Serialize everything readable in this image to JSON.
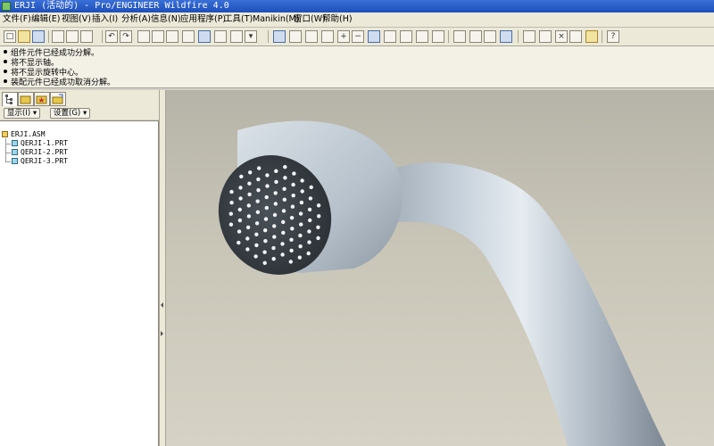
{
  "window": {
    "title": "ERJI (活动的) - Pro/ENGINEER Wildfire 4.0"
  },
  "menu": {
    "items": [
      {
        "label": "文件(F)"
      },
      {
        "label": "编辑(E)"
      },
      {
        "label": "视图(V)"
      },
      {
        "label": "插入(I)"
      },
      {
        "label": "分析(A)"
      },
      {
        "label": "信息(N)"
      },
      {
        "label": "应用程序(P)"
      },
      {
        "label": "工具(T)"
      },
      {
        "label": "Manikin(M)"
      },
      {
        "label": "窗口(W)"
      },
      {
        "label": "帮助(H)"
      }
    ]
  },
  "toolbar": {
    "icons": [
      "new-icon",
      "open-icon",
      "save-icon",
      "print-icon",
      "send-icon",
      "undo-icon",
      "redo-icon",
      "cut-icon",
      "copy-icon",
      "paste-icon",
      "regenerate-icon",
      "find-icon",
      "select-box-icon",
      "repaint-icon",
      "spin-center-icon",
      "orient-icon",
      "pan-icon",
      "zoom-in-icon",
      "zoom-out-icon",
      "refit-icon",
      "reorient-icon",
      "saved-views-icon",
      "layers-icon",
      "wireframe-icon",
      "hidden-line-icon",
      "no-hidden-icon",
      "shading-icon",
      "datum-planes-icon",
      "datum-axes-icon",
      "datum-points-icon",
      "coordinate-systems-icon",
      "context-help-icon"
    ]
  },
  "messages": {
    "lines": [
      "组件元件已经成功分解。",
      "将不显示轴。",
      "将不显示旋转中心。",
      "装配元件已经成功取消分解。"
    ]
  },
  "navigator": {
    "tabs": [
      "model-tree-icon",
      "folder-browser-icon",
      "favorites-icon",
      "connections-icon"
    ],
    "show_label": "显示(I)",
    "settings_label": "设置(G)"
  },
  "model_tree": {
    "root": "ERJI.ASM",
    "parts": [
      "QERJI-1.PRT",
      "QERJI-2.PRT",
      "QERJI-3.PRT"
    ]
  },
  "colors": {
    "model": "#c2ccd6",
    "background": "#c9c6b8",
    "title_bar": "#2a5cc6"
  }
}
